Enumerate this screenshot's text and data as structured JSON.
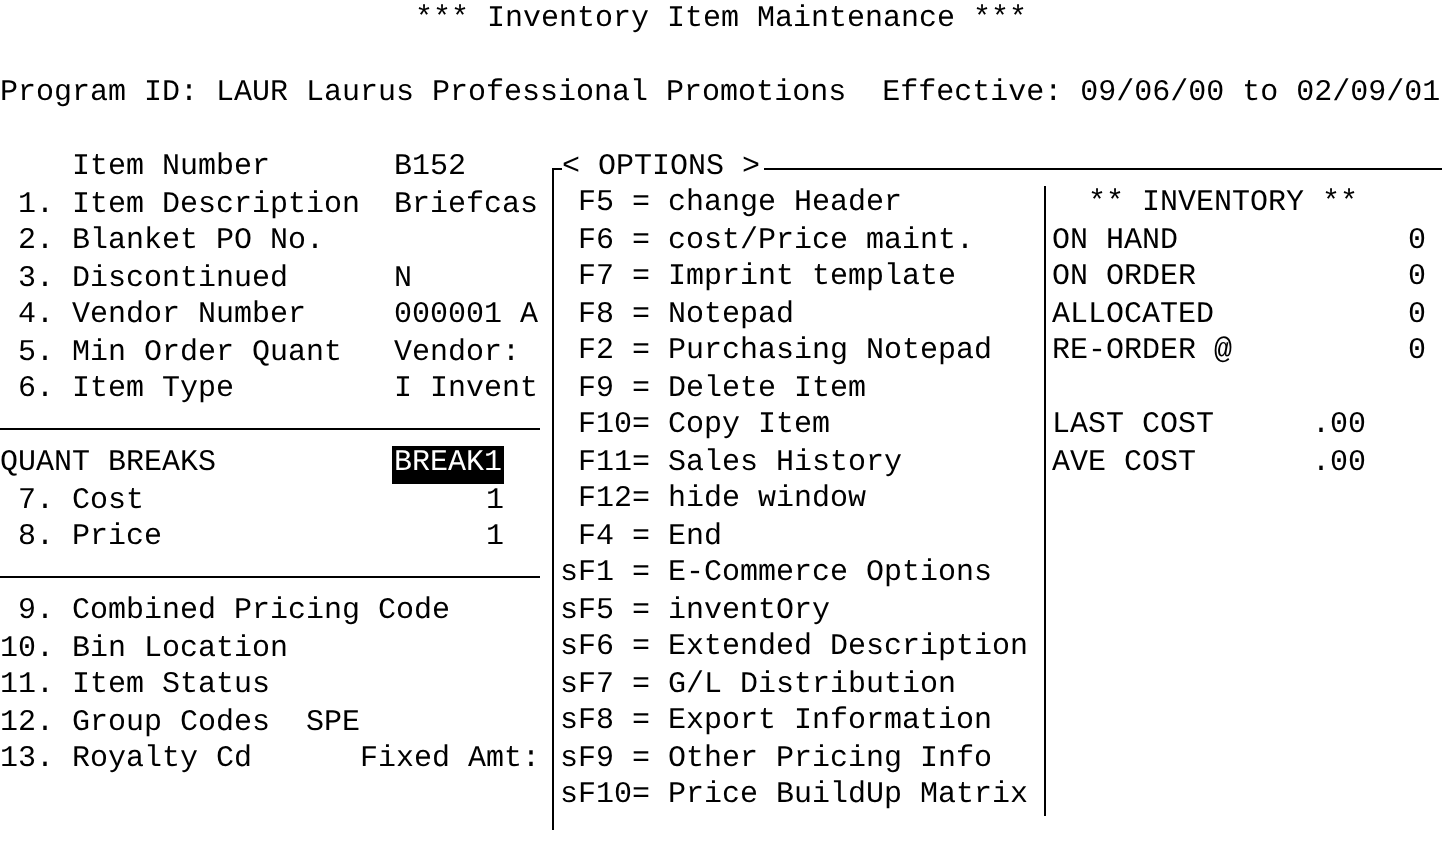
{
  "title": "*** Inventory Item Maintenance ***",
  "header": "Program ID: LAUR Laurus Professional Promotions  Effective: 09/06/00 to 02/09/01",
  "fields": [
    {
      "label": "Item Number",
      "value": "B152"
    },
    {
      "number": "1.",
      "label": "Item Description",
      "value": "Briefcas"
    },
    {
      "number": "2.",
      "label": "Blanket PO No."
    },
    {
      "number": "3.",
      "label": "Discontinued",
      "value": "N"
    },
    {
      "number": "4.",
      "label": "Vendor Number",
      "value": "000001 A"
    },
    {
      "number": "5.",
      "label": "Min Order Quant",
      "value": "Vendor:"
    },
    {
      "number": "6.",
      "label": "Item Type",
      "value": "I Invent"
    }
  ],
  "quant_breaks": {
    "label": "QUANT BREAKS",
    "value": "BREAK1",
    "selected": true,
    "rows": [
      {
        "number": "7.",
        "label": "Cost",
        "value": "1"
      },
      {
        "number": "8.",
        "label": "Price",
        "value": "1"
      }
    ]
  },
  "more_fields": [
    {
      "number": "9.",
      "label": "Combined Pricing Code"
    },
    {
      "number": "10.",
      "label": "Bin Location"
    },
    {
      "number": "11.",
      "label": "Item Status"
    },
    {
      "number": "12.",
      "label": "Group Codes",
      "kind": "inline",
      "value": "SPE"
    },
    {
      "number": "13.",
      "label": "Royalty Cd",
      "kind": "right",
      "value": "Fixed Amt:"
    }
  ],
  "options": {
    "title": "< OPTIONS >",
    "items": [
      {
        "kind": "key",
        "text": "F5 = change Header"
      },
      {
        "kind": "key",
        "text": "F6 = cost/Price maint."
      },
      {
        "kind": "key",
        "text": "F7 = Imprint template"
      },
      {
        "kind": "key",
        "text": "F8 = Notepad"
      },
      {
        "kind": "key",
        "text": "F2 = Purchasing Notepad"
      },
      {
        "kind": "key",
        "text": "F9 = Delete Item"
      },
      {
        "kind": "key",
        "text": "F10= Copy Item"
      },
      {
        "kind": "key",
        "text": "F11= Sales History"
      },
      {
        "kind": "key",
        "text": "F12= hide window"
      },
      {
        "kind": "key",
        "text": "F4 = End"
      },
      {
        "kind": "shift",
        "text": "sF1 = E-Commerce Options"
      },
      {
        "kind": "shift",
        "text": "sF5 = inventOry"
      },
      {
        "kind": "shift",
        "text": "sF6 = Extended Description"
      },
      {
        "kind": "shift",
        "text": "sF7 = G/L Distribution"
      },
      {
        "kind": "shift",
        "text": "sF8 = Export Information"
      },
      {
        "kind": "shift",
        "text": "sF9 = Other Pricing Info"
      },
      {
        "kind": "shift",
        "text": "sF10= Price BuildUp Matrix"
      }
    ]
  },
  "inventory": {
    "title": "** INVENTORY **",
    "quantities": [
      {
        "label": "ON HAND",
        "value": "0"
      },
      {
        "label": "ON ORDER",
        "value": "0"
      },
      {
        "label": "ALLOCATED",
        "value": "0"
      },
      {
        "label": "RE-ORDER @",
        "value": "0"
      }
    ],
    "costs": [
      {
        "label": "LAST COST",
        "value": ".00"
      },
      {
        "label": "AVE COST",
        "value": ".00"
      }
    ]
  }
}
